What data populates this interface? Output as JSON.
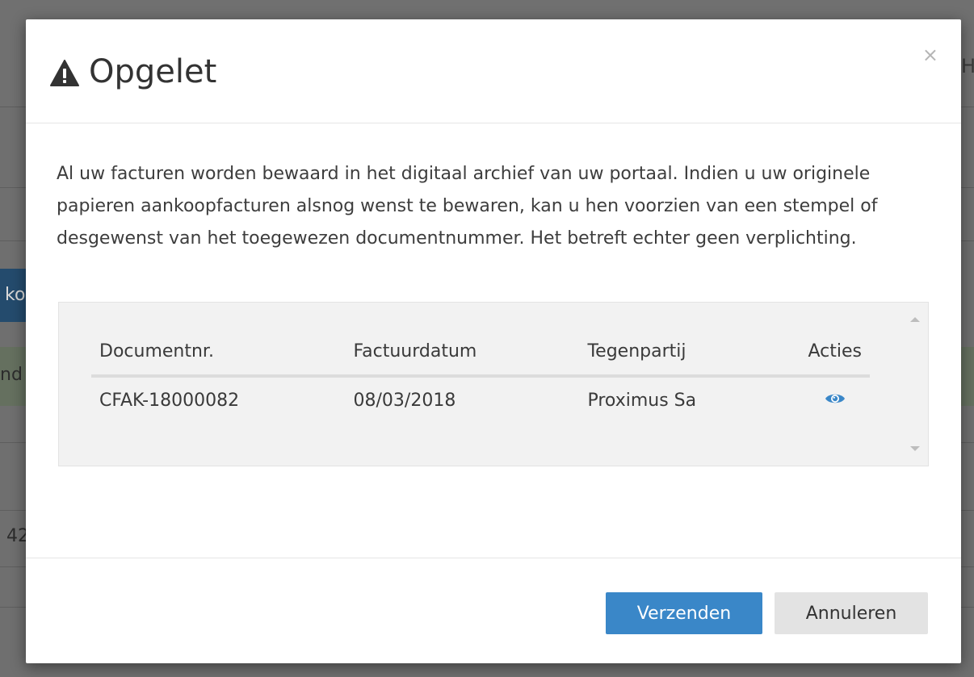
{
  "background": {
    "blue_tab_text": "ko",
    "green_row_text": "nd",
    "row_text": "42",
    "top_right_text": "H"
  },
  "modal": {
    "title": "Opgelet",
    "title_icon": "warning-triangle-icon",
    "close_label": "×",
    "body_text": "Al uw facturen worden bewaard in het digitaal archief van uw portaal. Indien u uw originele papieren aankoopfacturen alsnog wenst te bewaren, kan u hen voorzien van een stempel of desgewenst van het toegewezen documentnummer. Het betreft echter geen verplichting.",
    "table": {
      "headers": {
        "document_nr": "Documentnr.",
        "invoice_date": "Factuurdatum",
        "counterparty": "Tegenpartij",
        "actions": "Acties"
      },
      "rows": [
        {
          "document_nr": "CFAK-18000082",
          "invoice_date": "08/03/2018",
          "counterparty": "Proximus Sa",
          "action_icon": "eye-icon"
        }
      ]
    },
    "buttons": {
      "submit": "Verzenden",
      "cancel": "Annuleren"
    }
  },
  "colors": {
    "primary": "#3a87c8",
    "eye_icon": "#3a87c8",
    "overlay": "#6f6f6f"
  }
}
